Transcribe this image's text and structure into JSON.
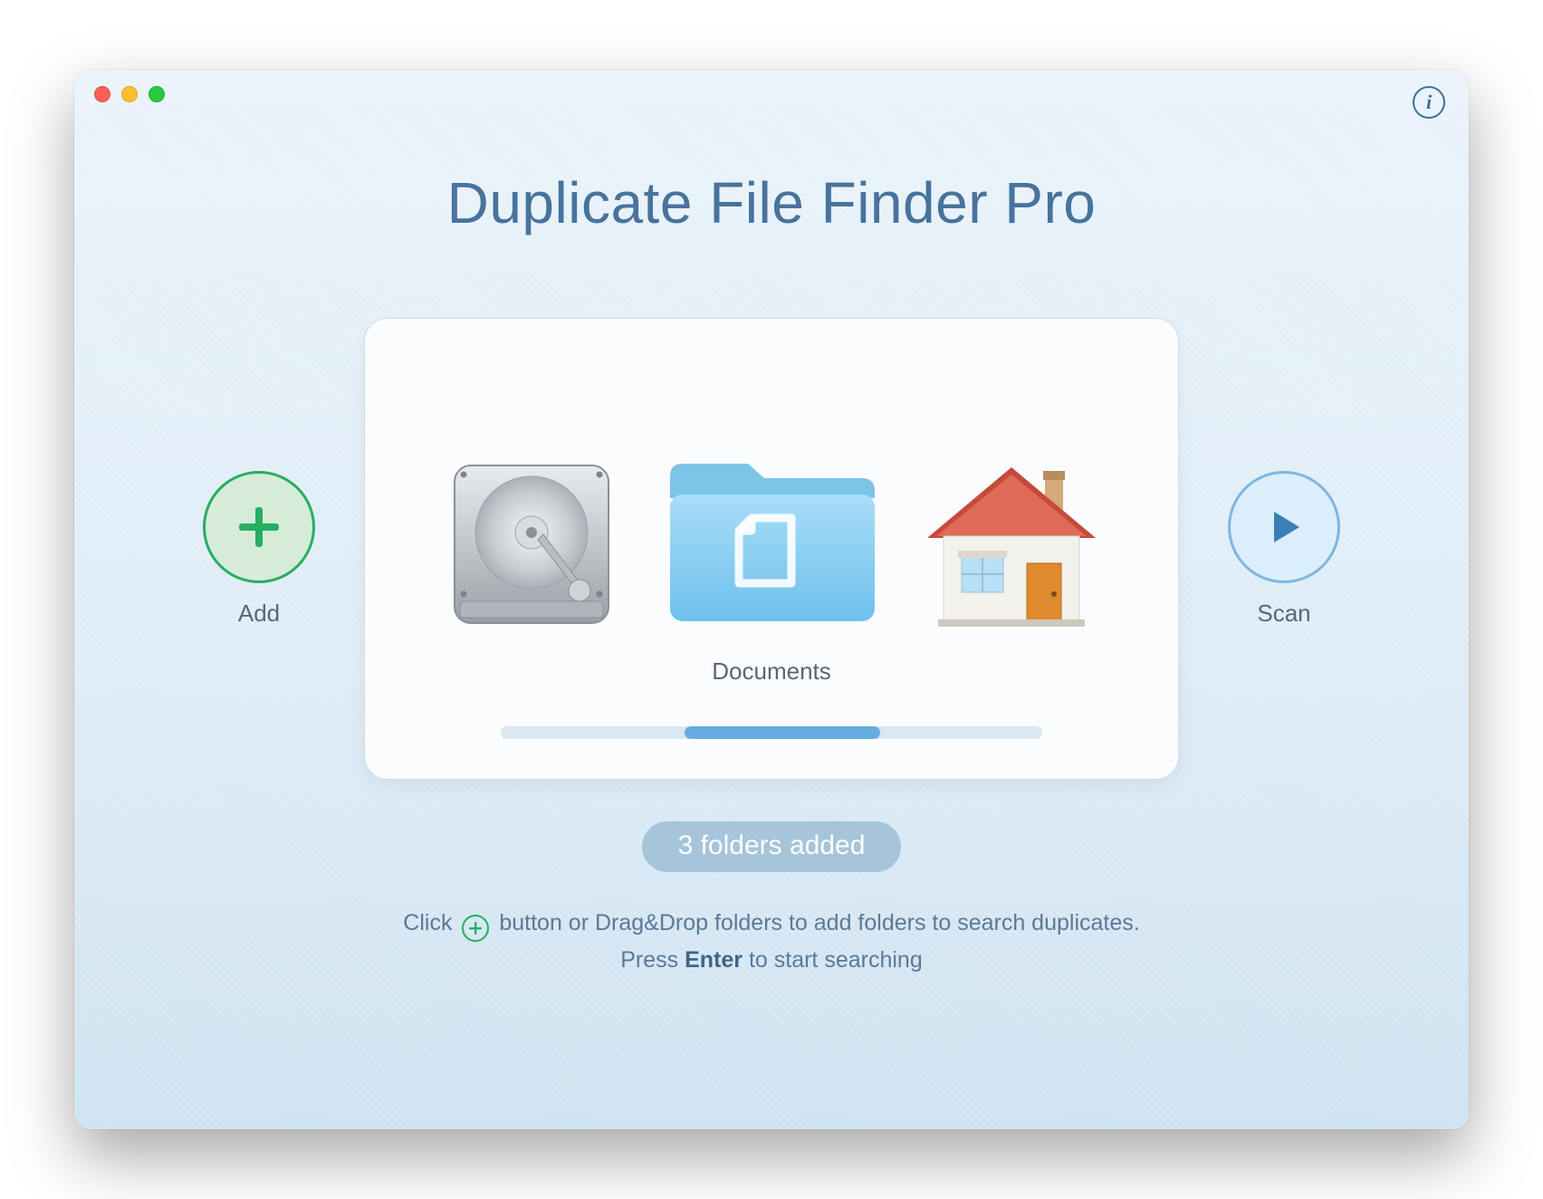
{
  "app": {
    "title": "Duplicate File Finder Pro"
  },
  "buttons": {
    "add_label": "Add",
    "scan_label": "Scan",
    "info_glyph": "i"
  },
  "card": {
    "center_label": "Documents",
    "items": [
      {
        "id": "disk",
        "label": ""
      },
      {
        "id": "documents",
        "label": "Documents"
      },
      {
        "id": "home",
        "label": ""
      }
    ]
  },
  "status": {
    "badge": "3 folders added"
  },
  "hints": {
    "line1_pre": "Click ",
    "line1_post": " button or Drag&Drop folders to add folders to search duplicates.",
    "line2_pre": "Press ",
    "line2_key": "Enter",
    "line2_post": " to start searching"
  },
  "colors": {
    "accent_green": "#27ae60",
    "accent_blue": "#66addf",
    "title_color": "#47739d"
  }
}
